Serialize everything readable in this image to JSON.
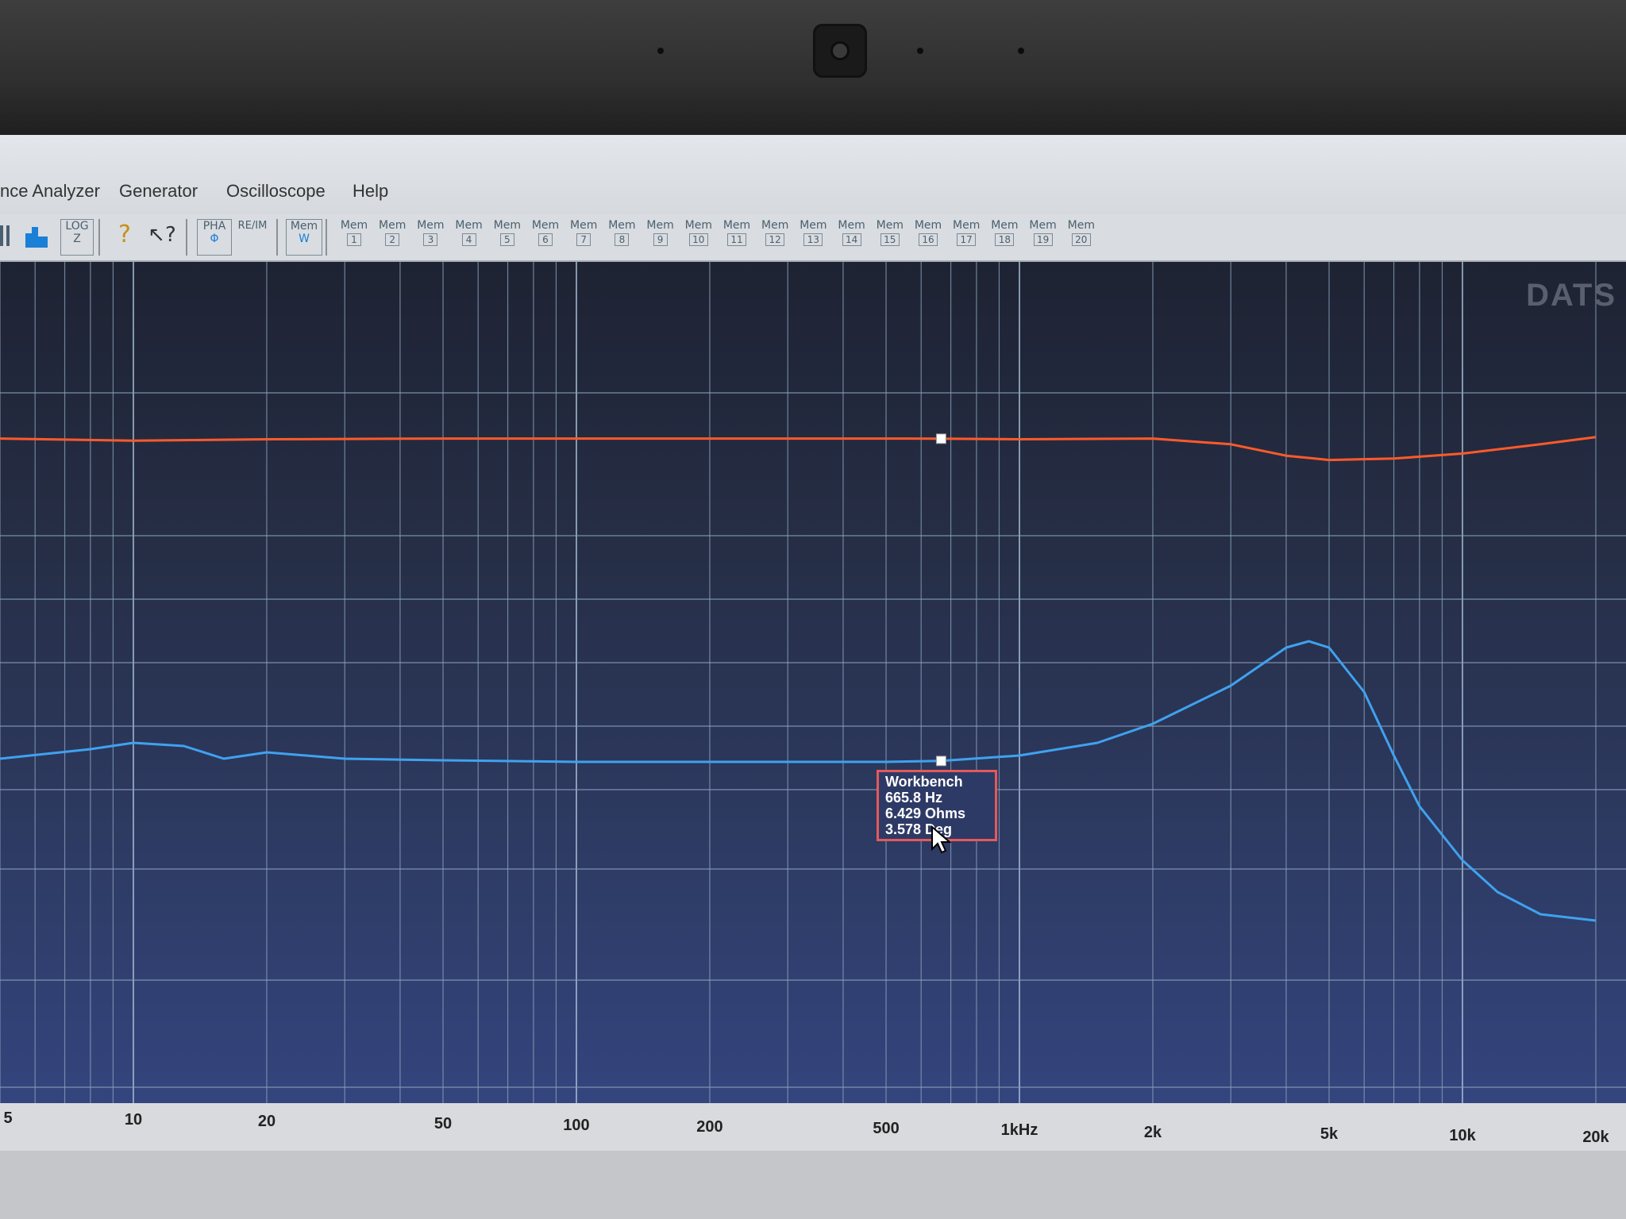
{
  "menu": [
    "nce Analyzer",
    "Generator",
    "Oscilloscope",
    "Help"
  ],
  "toolbar": {
    "log_label": "LOG",
    "log_sub": "Z",
    "pha_label": "PHA",
    "reim_label": "RE/IM",
    "mem_label": "Mem",
    "mem_w": "W",
    "mem_slots": [
      "1",
      "2",
      "3",
      "4",
      "5",
      "6",
      "7",
      "8",
      "9",
      "10",
      "11",
      "12",
      "13",
      "14",
      "15",
      "16",
      "17",
      "18",
      "19",
      "20"
    ]
  },
  "watermark": "DATS",
  "tooltip": {
    "name": "Workbench",
    "freq": "665.8 Hz",
    "impedance": "6.429 Ohms",
    "phase": "3.578 Deg"
  },
  "chart_data": {
    "type": "line",
    "xscale": "log",
    "xlim": [
      5,
      20000
    ],
    "tick_labels": [
      "5",
      "10",
      "20",
      "50",
      "100",
      "200",
      "500",
      "1kHz",
      "2k",
      "5k",
      "10k",
      "20k"
    ],
    "series": [
      {
        "color": "#ff5a2a",
        "x": [
          5,
          10,
          20,
          50,
          100,
          200,
          500,
          665.8,
          1000,
          2000,
          3000,
          4000,
          5000,
          7000,
          10000,
          15000,
          20000
        ],
        "y": [
          3.6,
          3.3,
          3.5,
          3.6,
          3.6,
          3.6,
          3.6,
          3.578,
          3.5,
          3.6,
          2.8,
          1.2,
          0.6,
          0.8,
          1.5,
          2.8,
          3.8
        ]
      },
      {
        "color": "#3fa2ef",
        "x": [
          5,
          8,
          10,
          13,
          16,
          20,
          30,
          50,
          100,
          200,
          500,
          665.8,
          1000,
          1500,
          2000,
          3000,
          4000,
          4500,
          5000,
          6000,
          7000,
          8000,
          10000,
          12000,
          15000,
          20000
        ],
        "y": [
          6.5,
          6.8,
          7.0,
          6.9,
          6.5,
          6.7,
          6.5,
          6.45,
          6.4,
          6.4,
          6.4,
          6.429,
          6.6,
          7.0,
          7.6,
          8.8,
          10.0,
          10.2,
          10.0,
          8.6,
          6.6,
          5.0,
          3.3,
          2.3,
          1.6,
          1.4
        ]
      }
    ]
  }
}
